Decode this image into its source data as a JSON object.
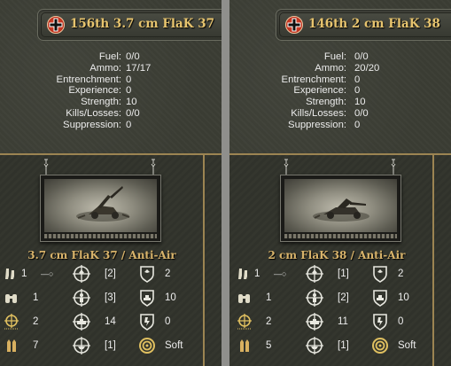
{
  "panels": [
    {
      "name": "156th 3.7 cm FlaK 37",
      "stats": [
        {
          "label": "Fuel:",
          "value": "0/0"
        },
        {
          "label": "Ammo:",
          "value": "17/17"
        },
        {
          "label": "Entrenchment:",
          "value": "0"
        },
        {
          "label": "Experience:",
          "value": "0"
        },
        {
          "label": "Strength:",
          "value": "10"
        },
        {
          "label": "Kills/Losses:",
          "value": "0/0"
        },
        {
          "label": "Suppression:",
          "value": "0"
        }
      ],
      "unit_class": "3.7 cm FlaK 37 / Anti-Air",
      "grid": [
        {
          "a": "1",
          "b": "[2]",
          "c": "2"
        },
        {
          "a": "1",
          "b": "[3]",
          "c": "10"
        },
        {
          "a": "2",
          "b": "14",
          "c": "0"
        },
        {
          "a": "7",
          "b": "[1]",
          "c": "Soft"
        }
      ]
    },
    {
      "name": "146th 2 cm FlaK 38",
      "stats": [
        {
          "label": "Fuel:",
          "value": "0/0"
        },
        {
          "label": "Ammo:",
          "value": "20/20"
        },
        {
          "label": "Entrenchment:",
          "value": "0"
        },
        {
          "label": "Experience:",
          "value": "0"
        },
        {
          "label": "Strength:",
          "value": "10"
        },
        {
          "label": "Kills/Losses:",
          "value": "0/0"
        },
        {
          "label": "Suppression:",
          "value": "0"
        }
      ],
      "unit_class": "2 cm FlaK 38 / Anti-Air",
      "grid": [
        {
          "a": "1",
          "b": "[1]",
          "c": "2"
        },
        {
          "a": "1",
          "b": "[2]",
          "c": "10"
        },
        {
          "a": "2",
          "b": "11",
          "c": "0"
        },
        {
          "a": "5",
          "b": "[1]",
          "c": "Soft"
        }
      ]
    }
  ],
  "icons": {
    "nation": "iron-cross-roundel-icon",
    "row_left": [
      "movement-boots-icon",
      "spotting-binoculars-icon",
      "range-crosshair-icon",
      "ammo-shells-icon"
    ],
    "row_mid": [
      "air-attack-crosshair-icon",
      "soft-attack-crosshair-icon",
      "hard-attack-crosshair-icon",
      "naval-attack-crosshair-icon"
    ],
    "row_right": [
      "air-defense-shield-icon",
      "ground-defense-shield-icon",
      "close-defense-shield-icon",
      "target-type-icon"
    ]
  },
  "colors": {
    "gold_text": "#e7c46e",
    "frame_gold": "#9c8452",
    "panel_bg": "#3a3c33",
    "nation_red": "#c0301c"
  }
}
